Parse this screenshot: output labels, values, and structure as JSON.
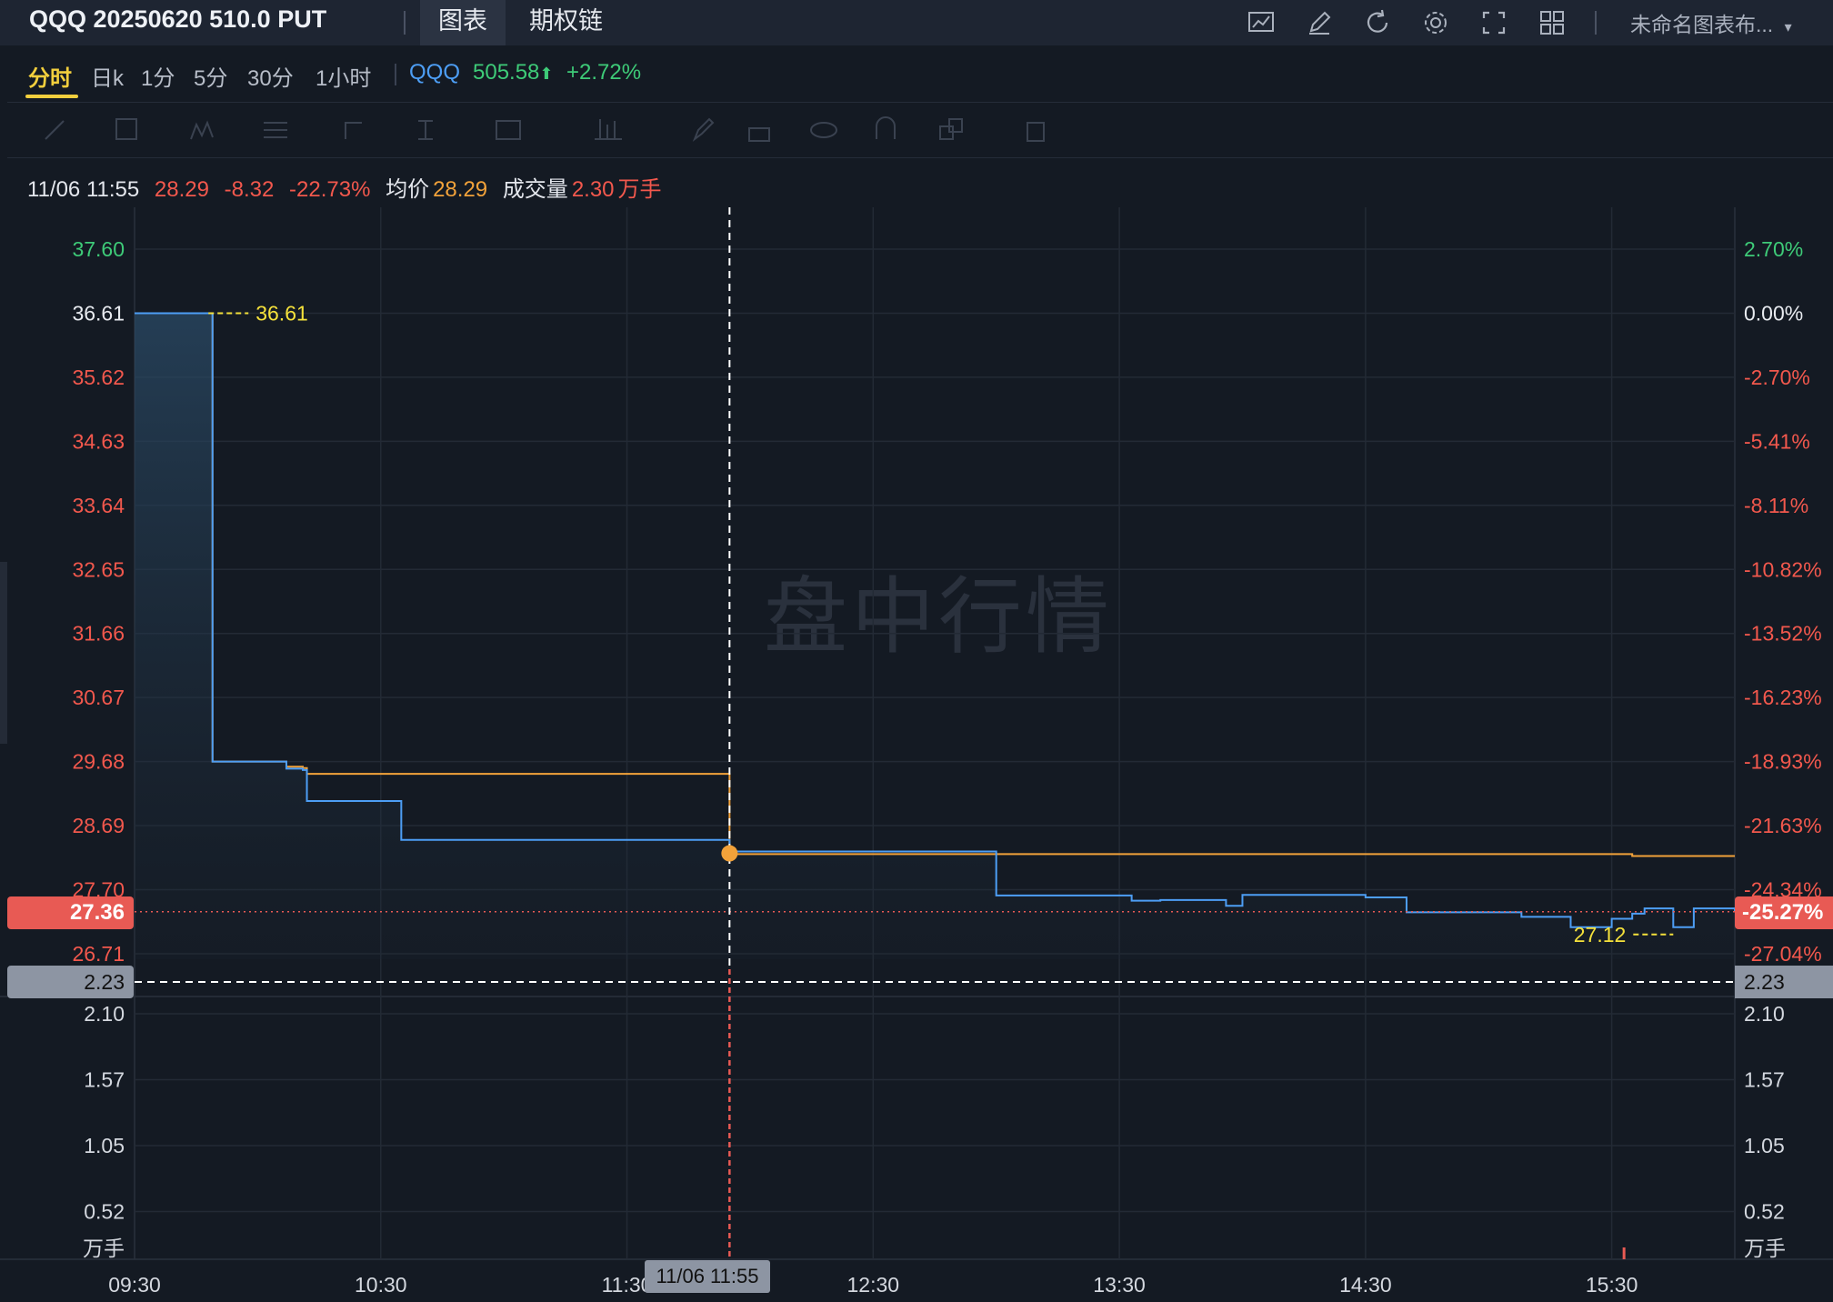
{
  "header": {
    "title": "QQQ 20250620 510.0 PUT",
    "tabs": [
      "图表",
      "期权链"
    ],
    "toolbar_icons": [
      "chart-indicator-icon",
      "draw-pen-icon",
      "refresh-icon",
      "settings-gear-icon",
      "fullscreen-icon",
      "layout-grid-icon"
    ],
    "layout_name": "未命名图表布...",
    "layout_dropdown": "▾"
  },
  "intervals": [
    "分时",
    "日k",
    "1分",
    "5分",
    "30分",
    "1小时"
  ],
  "active_interval": "分时",
  "underlying": {
    "symbol": "QQQ",
    "price": "505.58",
    "arrow": "⬆",
    "change": "+2.72%"
  },
  "info": {
    "datetime": "11/06 11:55",
    "price": "28.29",
    "change": "-8.32",
    "change_pct": "-22.73%",
    "avg_label": "均价",
    "avg_value": "28.29",
    "volume_label": "成交量",
    "volume_value": "2.30",
    "volume_unit": "万手"
  },
  "watermark": "盘中行情",
  "price_axis_left": [
    "37.60",
    "36.61",
    "35.62",
    "34.63",
    "33.64",
    "32.65",
    "31.66",
    "30.67",
    "29.68",
    "28.69",
    "27.70",
    "26.71"
  ],
  "price_axis_right": [
    "2.70%",
    "0.00%",
    "-2.70%",
    "-5.41%",
    "-8.11%",
    "-10.82%",
    "-13.52%",
    "-16.23%",
    "-18.93%",
    "-21.63%",
    "-24.34%",
    "-27.04%"
  ],
  "volume_axis": [
    "2.10",
    "1.57",
    "1.05",
    "0.52"
  ],
  "volume_unit_label": "万手",
  "time_axis": [
    "09:30",
    "10:30",
    "11:30",
    "12:30",
    "13:30",
    "14:30",
    "15:30"
  ],
  "crosshair_time": "11/06 11:55",
  "crosshair_volume": "2.23",
  "last_price_badge": "27.36",
  "last_pct_badge": "-25.27%",
  "high_marker": "36.61",
  "low_marker": "27.12",
  "colors": {
    "price_line": "#4d9ef5",
    "avg_line": "#f2a23a",
    "up": "#3ecb78",
    "down": "#f2584d",
    "marker": "#f5e13b"
  },
  "chart_data": {
    "type": "line",
    "title": "",
    "x": [
      "09:30",
      "09:48",
      "09:49",
      "10:03",
      "10:07",
      "10:11",
      "10:12",
      "10:30",
      "10:34",
      "10:35",
      "11:55",
      "11:55",
      "12:27",
      "12:40",
      "13:00",
      "13:30",
      "13:33",
      "13:40",
      "13:50",
      "13:56",
      "14:00",
      "14:10",
      "14:25",
      "14:30",
      "14:40",
      "14:50",
      "15:03",
      "15:08",
      "15:15",
      "15:20",
      "15:30",
      "15:35",
      "15:38",
      "15:42",
      "15:45",
      "15:50",
      "15:55",
      "16:00"
    ],
    "series": [
      {
        "name": "",
        "values": [
          36.61,
          36.61,
          29.68,
          29.68,
          29.57,
          29.55,
          29.07,
          29.07,
          29.07,
          28.47,
          28.47,
          28.29,
          28.29,
          28.29,
          27.61,
          27.61,
          27.53,
          27.54,
          27.54,
          27.45,
          27.62,
          27.62,
          27.62,
          27.58,
          27.35,
          27.35,
          27.35,
          27.28,
          27.28,
          27.12,
          27.25,
          27.33,
          27.41,
          27.41,
          27.12,
          27.41,
          27.41,
          27.36
        ]
      },
      {
        "name": "均价",
        "values": [
          36.61,
          36.61,
          29.68,
          29.68,
          29.6,
          29.58,
          29.49,
          29.49,
          29.49,
          29.49,
          29.47,
          28.25,
          28.25,
          28.25,
          28.25,
          28.25,
          28.25,
          28.25,
          28.25,
          28.25,
          28.25,
          28.25,
          28.25,
          28.25,
          28.25,
          28.25,
          28.25,
          28.25,
          28.25,
          28.25,
          28.25,
          28.22,
          28.22,
          28.22,
          28.22,
          28.22,
          28.22,
          28.22
        ]
      }
    ],
    "ylim": [
      26.71,
      37.6
    ],
    "xlabel": "",
    "ylabel": "",
    "grid": true
  }
}
